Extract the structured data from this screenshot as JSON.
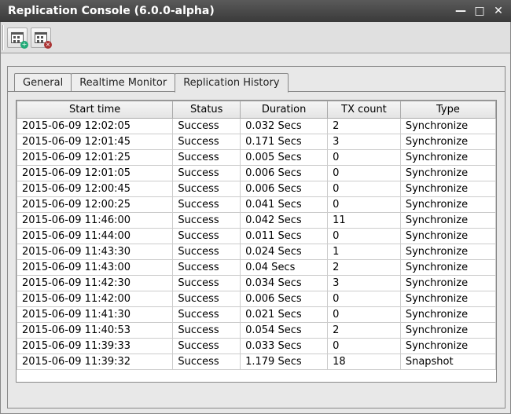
{
  "window": {
    "title": "Replication Console (6.0.0-alpha)"
  },
  "toolbar": {
    "btn_schedule_add": "schedule-add",
    "btn_schedule_remove": "schedule-remove"
  },
  "tabs": {
    "general": "General",
    "realtime": "Realtime Monitor",
    "history": "Replication History"
  },
  "table": {
    "headers": {
      "start": "Start time",
      "status": "Status",
      "duration": "Duration",
      "tx": "TX count",
      "type": "Type"
    },
    "rows": [
      {
        "start": "2015-06-09 12:02:05",
        "status": "Success",
        "duration": "0.032 Secs",
        "tx": "2",
        "type": "Synchronize"
      },
      {
        "start": "2015-06-09 12:01:45",
        "status": "Success",
        "duration": "0.171 Secs",
        "tx": "3",
        "type": "Synchronize"
      },
      {
        "start": "2015-06-09 12:01:25",
        "status": "Success",
        "duration": "0.005 Secs",
        "tx": "0",
        "type": "Synchronize"
      },
      {
        "start": "2015-06-09 12:01:05",
        "status": "Success",
        "duration": "0.006 Secs",
        "tx": "0",
        "type": "Synchronize"
      },
      {
        "start": "2015-06-09 12:00:45",
        "status": "Success",
        "duration": "0.006 Secs",
        "tx": "0",
        "type": "Synchronize"
      },
      {
        "start": "2015-06-09 12:00:25",
        "status": "Success",
        "duration": "0.041 Secs",
        "tx": "0",
        "type": "Synchronize"
      },
      {
        "start": "2015-06-09 11:46:00",
        "status": "Success",
        "duration": "0.042 Secs",
        "tx": "11",
        "type": "Synchronize"
      },
      {
        "start": "2015-06-09 11:44:00",
        "status": "Success",
        "duration": "0.011 Secs",
        "tx": "0",
        "type": "Synchronize"
      },
      {
        "start": "2015-06-09 11:43:30",
        "status": "Success",
        "duration": "0.024 Secs",
        "tx": "1",
        "type": "Synchronize"
      },
      {
        "start": "2015-06-09 11:43:00",
        "status": "Success",
        "duration": "0.04 Secs",
        "tx": "2",
        "type": "Synchronize"
      },
      {
        "start": "2015-06-09 11:42:30",
        "status": "Success",
        "duration": "0.034 Secs",
        "tx": "3",
        "type": "Synchronize"
      },
      {
        "start": "2015-06-09 11:42:00",
        "status": "Success",
        "duration": "0.006 Secs",
        "tx": "0",
        "type": "Synchronize"
      },
      {
        "start": "2015-06-09 11:41:30",
        "status": "Success",
        "duration": "0.021 Secs",
        "tx": "0",
        "type": "Synchronize"
      },
      {
        "start": "2015-06-09 11:40:53",
        "status": "Success",
        "duration": "0.054 Secs",
        "tx": "2",
        "type": "Synchronize"
      },
      {
        "start": "2015-06-09 11:39:33",
        "status": "Success",
        "duration": "0.033 Secs",
        "tx": "0",
        "type": "Synchronize"
      },
      {
        "start": "2015-06-09 11:39:32",
        "status": "Success",
        "duration": "1.179 Secs",
        "tx": "18",
        "type": "Snapshot"
      }
    ]
  }
}
